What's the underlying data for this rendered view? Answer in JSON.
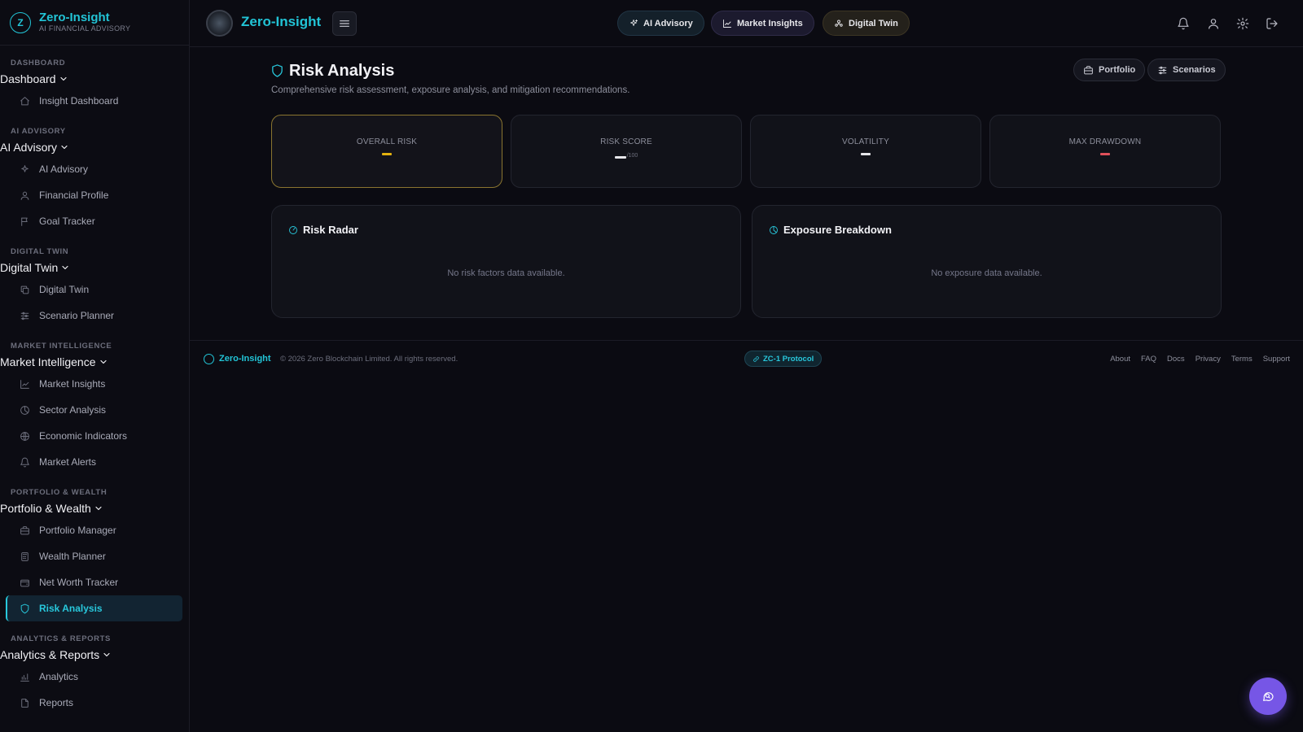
{
  "brand": {
    "name": "Zero-Insight",
    "tagline": "AI FINANCIAL ADVISORY",
    "logo_letter": "Z"
  },
  "sidebar": {
    "sections": [
      {
        "label": "DASHBOARD",
        "group": "Dashboard",
        "items": [
          {
            "label": "Insight Dashboard",
            "icon": "home-icon"
          }
        ]
      },
      {
        "label": "AI ADVISORY",
        "group": "AI Advisory",
        "items": [
          {
            "label": "AI Advisory",
            "icon": "sparkles-icon"
          },
          {
            "label": "Financial Profile",
            "icon": "user-icon"
          },
          {
            "label": "Goal Tracker",
            "icon": "flag-icon"
          }
        ]
      },
      {
        "label": "DIGITAL TWIN",
        "group": "Digital Twin",
        "items": [
          {
            "label": "Digital Twin",
            "icon": "copy-icon"
          },
          {
            "label": "Scenario Planner",
            "icon": "sliders-icon"
          }
        ]
      },
      {
        "label": "MARKET INTELLIGENCE",
        "group": "Market Intelligence",
        "items": [
          {
            "label": "Market Insights",
            "icon": "chart-line-icon"
          },
          {
            "label": "Sector Analysis",
            "icon": "pie-icon"
          },
          {
            "label": "Economic Indicators",
            "icon": "globe-icon"
          },
          {
            "label": "Market Alerts",
            "icon": "bell-icon"
          }
        ]
      },
      {
        "label": "PORTFOLIO & WEALTH",
        "group": "Portfolio & Wealth",
        "items": [
          {
            "label": "Portfolio Manager",
            "icon": "briefcase-icon"
          },
          {
            "label": "Wealth Planner",
            "icon": "calculator-icon"
          },
          {
            "label": "Net Worth Tracker",
            "icon": "wallet-icon"
          },
          {
            "label": "Risk Analysis",
            "icon": "shield-icon",
            "active": true
          }
        ]
      },
      {
        "label": "ANALYTICS & REPORTS",
        "group": "Analytics & Reports",
        "items": [
          {
            "label": "Analytics",
            "icon": "bar-chart-icon"
          },
          {
            "label": "Reports",
            "icon": "file-icon"
          }
        ]
      }
    ]
  },
  "topbar": {
    "title": "Zero-Insight",
    "pills": {
      "advisory": "AI Advisory",
      "market": "Market Insights",
      "twin": "Digital Twin"
    }
  },
  "page": {
    "title": "Risk Analysis",
    "subtitle": "Comprehensive risk assessment, exposure analysis, and mitigation recommendations.",
    "buttons": {
      "portfolio": "Portfolio",
      "scenarios": "Scenarios"
    }
  },
  "stats": [
    {
      "label": "OVERALL RISK",
      "value": "—",
      "color": "#e3b20f",
      "unit": ""
    },
    {
      "label": "RISK SCORE",
      "value": "—",
      "color": "#e6e6ea",
      "unit": "/100"
    },
    {
      "label": "VOLATILITY",
      "value": "—",
      "color": "#e6e6ea",
      "unit": ""
    },
    {
      "label": "MAX DRAWDOWN",
      "value": "—",
      "color": "#e0505a",
      "unit": ""
    }
  ],
  "panels": {
    "radar": {
      "title": "Risk Radar",
      "empty": "No risk factors data available."
    },
    "exposure": {
      "title": "Exposure Breakdown",
      "empty": "No exposure data available."
    }
  },
  "footer": {
    "name": "Zero-Insight",
    "copyright": "© 2026 Zero Blockchain Limited. All rights reserved.",
    "badge": "ZC-1 Protocol",
    "links": [
      "About",
      "FAQ",
      "Docs",
      "Privacy",
      "Terms",
      "Support"
    ]
  },
  "colors": {
    "accent": "#28c8dc",
    "highlight_border": "#8a7530",
    "fab": "#7656e6"
  }
}
